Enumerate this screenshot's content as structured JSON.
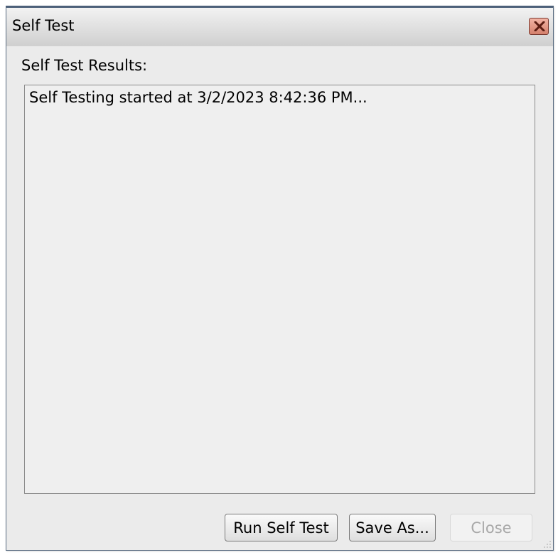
{
  "window": {
    "title": "Self Test"
  },
  "results": {
    "label": "Self Test Results:",
    "text": "Self Testing started at 3/2/2023 8:42:36 PM..."
  },
  "buttons": {
    "run": "Run Self Test",
    "save": "Save As...",
    "close": "Close"
  },
  "icons": {
    "close": "close-icon",
    "resize": "resize-grip-icon"
  },
  "colors": {
    "close_button": "#d4806c",
    "window_border": "#4c6079",
    "background": "#ebebeb"
  }
}
